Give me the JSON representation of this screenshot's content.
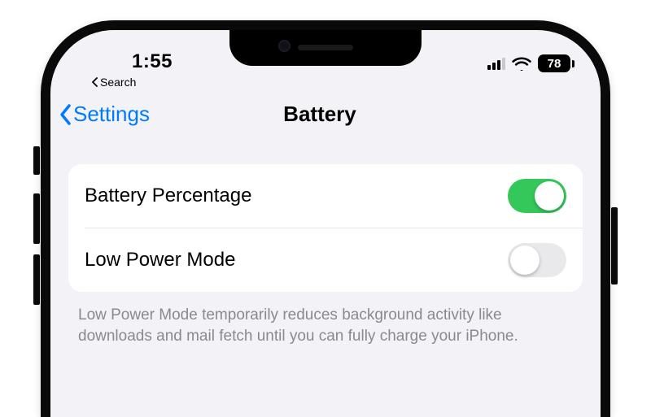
{
  "status": {
    "time": "1:55",
    "back_app_label": "Search",
    "cellular_bars_active": 3,
    "battery_percent": "78"
  },
  "nav": {
    "back_label": "Settings",
    "title": "Battery"
  },
  "settings": {
    "rows": [
      {
        "label": "Battery Percentage",
        "on": true
      },
      {
        "label": "Low Power Mode",
        "on": false
      }
    ],
    "footer": "Low Power Mode temporarily reduces background activity like downloads and mail fetch until you can fully charge your iPhone."
  },
  "colors": {
    "ios_blue": "#007aff",
    "ios_green": "#34c759",
    "bg_grouped": "#f2f2f7"
  }
}
